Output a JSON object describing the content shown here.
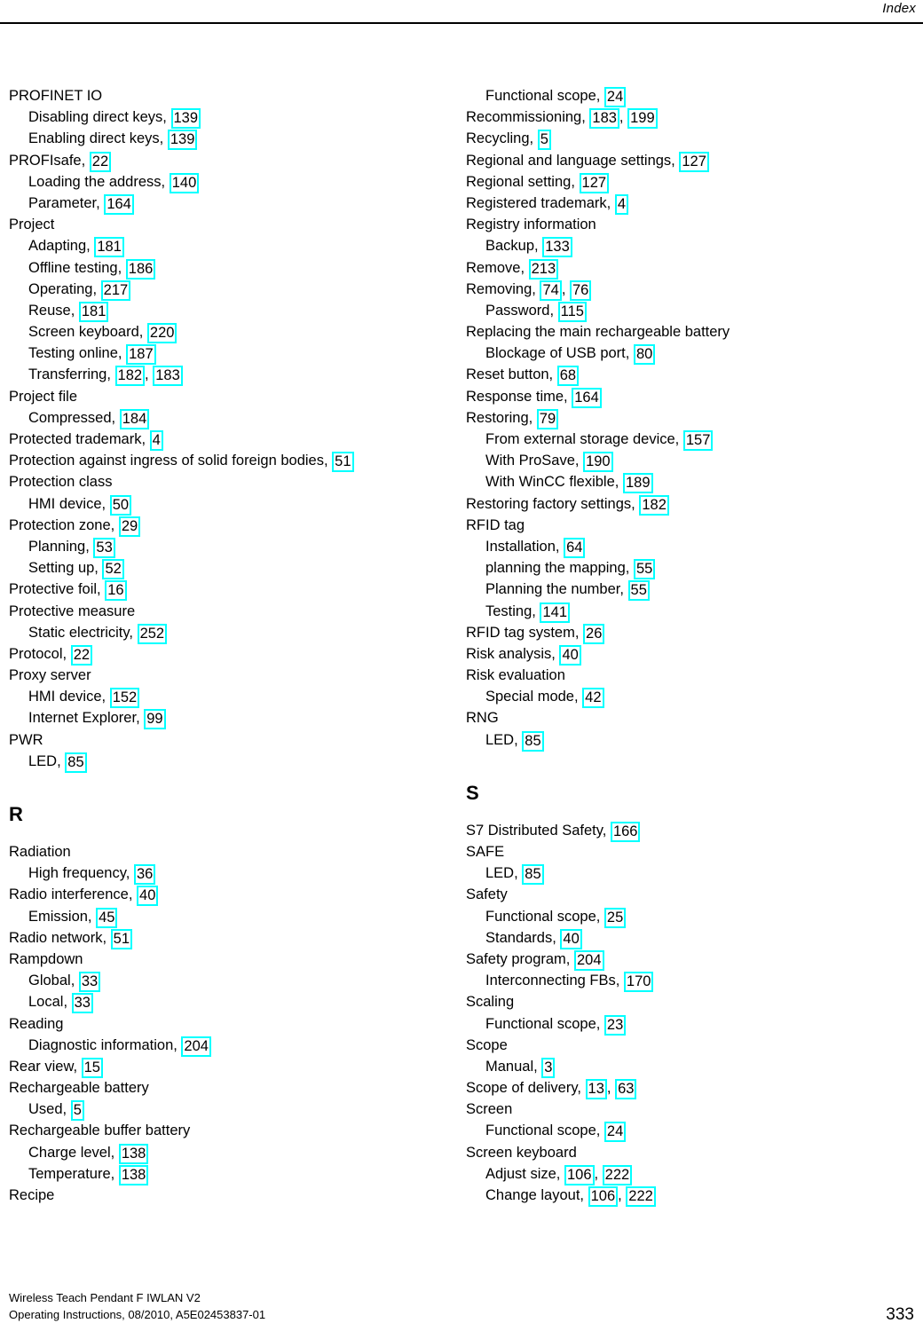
{
  "header": {
    "title": "Index"
  },
  "footer": {
    "line1": "Wireless Teach Pendant F IWLAN V2",
    "line2": "Operating Instructions, 08/2010, A5E02453837-01",
    "page_number": "333"
  },
  "colors": {
    "highlight_border": "#00ffff",
    "text": "#000000",
    "background": "#ffffff"
  },
  "columns": {
    "left": [
      {
        "type": "entry",
        "level": 1,
        "text": "PROFINET IO",
        "pages": []
      },
      {
        "type": "entry",
        "level": 2,
        "text": "Disabling direct keys,",
        "pages": [
          "139"
        ]
      },
      {
        "type": "entry",
        "level": 2,
        "text": "Enabling direct keys,",
        "pages": [
          "139"
        ]
      },
      {
        "type": "entry",
        "level": 1,
        "text": "PROFIsafe,",
        "pages": [
          "22"
        ]
      },
      {
        "type": "entry",
        "level": 2,
        "text": "Loading the address,",
        "pages": [
          "140"
        ]
      },
      {
        "type": "entry",
        "level": 2,
        "text": "Parameter,",
        "pages": [
          "164"
        ]
      },
      {
        "type": "entry",
        "level": 1,
        "text": "Project",
        "pages": []
      },
      {
        "type": "entry",
        "level": 2,
        "text": "Adapting,",
        "pages": [
          "181"
        ]
      },
      {
        "type": "entry",
        "level": 2,
        "text": "Offline testing,",
        "pages": [
          "186"
        ]
      },
      {
        "type": "entry",
        "level": 2,
        "text": "Operating,",
        "pages": [
          "217"
        ]
      },
      {
        "type": "entry",
        "level": 2,
        "text": "Reuse,",
        "pages": [
          "181"
        ]
      },
      {
        "type": "entry",
        "level": 2,
        "text": "Screen keyboard,",
        "pages": [
          "220"
        ]
      },
      {
        "type": "entry",
        "level": 2,
        "text": "Testing online,",
        "pages": [
          "187"
        ]
      },
      {
        "type": "entry",
        "level": 2,
        "text": "Transferring,",
        "pages": [
          "182",
          "183"
        ]
      },
      {
        "type": "entry",
        "level": 1,
        "text": "Project file",
        "pages": []
      },
      {
        "type": "entry",
        "level": 2,
        "text": "Compressed,",
        "pages": [
          "184"
        ]
      },
      {
        "type": "entry",
        "level": 1,
        "text": "Protected trademark,",
        "pages": [
          "4"
        ]
      },
      {
        "type": "entry",
        "level": 1,
        "text": "Protection against ingress of solid foreign bodies,",
        "pages": [
          "51"
        ]
      },
      {
        "type": "entry",
        "level": 1,
        "text": "Protection class",
        "pages": []
      },
      {
        "type": "entry",
        "level": 2,
        "text": "HMI device,",
        "pages": [
          "50"
        ]
      },
      {
        "type": "entry",
        "level": 1,
        "text": "Protection zone,",
        "pages": [
          "29"
        ]
      },
      {
        "type": "entry",
        "level": 2,
        "text": "Planning,",
        "pages": [
          "53"
        ]
      },
      {
        "type": "entry",
        "level": 2,
        "text": "Setting up,",
        "pages": [
          "52"
        ]
      },
      {
        "type": "entry",
        "level": 1,
        "text": "Protective foil,",
        "pages": [
          "16"
        ]
      },
      {
        "type": "entry",
        "level": 1,
        "text": "Protective measure",
        "pages": []
      },
      {
        "type": "entry",
        "level": 2,
        "text": "Static electricity,",
        "pages": [
          "252"
        ]
      },
      {
        "type": "entry",
        "level": 1,
        "text": "Protocol,",
        "pages": [
          "22"
        ]
      },
      {
        "type": "entry",
        "level": 1,
        "text": "Proxy server",
        "pages": []
      },
      {
        "type": "entry",
        "level": 2,
        "text": "HMI device,",
        "pages": [
          "152"
        ]
      },
      {
        "type": "entry",
        "level": 2,
        "text": "Internet Explorer,",
        "pages": [
          "99"
        ]
      },
      {
        "type": "entry",
        "level": 1,
        "text": "PWR",
        "pages": []
      },
      {
        "type": "entry",
        "level": 2,
        "text": "LED,",
        "pages": [
          "85"
        ]
      },
      {
        "type": "heading",
        "text": "R"
      },
      {
        "type": "entry",
        "level": 1,
        "text": "Radiation",
        "pages": []
      },
      {
        "type": "entry",
        "level": 2,
        "text": "High frequency,",
        "pages": [
          "36"
        ]
      },
      {
        "type": "entry",
        "level": 1,
        "text": "Radio interference,",
        "pages": [
          "40"
        ]
      },
      {
        "type": "entry",
        "level": 2,
        "text": "Emission,",
        "pages": [
          "45"
        ]
      },
      {
        "type": "entry",
        "level": 1,
        "text": "Radio network,",
        "pages": [
          "51"
        ]
      },
      {
        "type": "entry",
        "level": 1,
        "text": "Rampdown",
        "pages": []
      },
      {
        "type": "entry",
        "level": 2,
        "text": "Global,",
        "pages": [
          "33"
        ]
      },
      {
        "type": "entry",
        "level": 2,
        "text": "Local,",
        "pages": [
          "33"
        ]
      },
      {
        "type": "entry",
        "level": 1,
        "text": "Reading",
        "pages": []
      },
      {
        "type": "entry",
        "level": 2,
        "text": "Diagnostic information,",
        "pages": [
          "204"
        ]
      },
      {
        "type": "entry",
        "level": 1,
        "text": "Rear view,",
        "pages": [
          "15"
        ]
      },
      {
        "type": "entry",
        "level": 1,
        "text": "Rechargeable battery",
        "pages": []
      },
      {
        "type": "entry",
        "level": 2,
        "text": "Used,",
        "pages": [
          "5"
        ]
      },
      {
        "type": "entry",
        "level": 1,
        "text": "Rechargeable buffer battery",
        "pages": []
      },
      {
        "type": "entry",
        "level": 2,
        "text": "Charge level,",
        "pages": [
          "138"
        ]
      },
      {
        "type": "entry",
        "level": 2,
        "text": "Temperature,",
        "pages": [
          "138"
        ]
      },
      {
        "type": "entry",
        "level": 1,
        "text": "Recipe",
        "pages": []
      }
    ],
    "right": [
      {
        "type": "entry",
        "level": 2,
        "text": "Functional scope,",
        "pages": [
          "24"
        ]
      },
      {
        "type": "entry",
        "level": 1,
        "text": "Recommissioning,",
        "pages": [
          "183",
          "199"
        ]
      },
      {
        "type": "entry",
        "level": 1,
        "text": "Recycling,",
        "pages": [
          "5"
        ]
      },
      {
        "type": "entry",
        "level": 1,
        "text": "Regional and language settings,",
        "pages": [
          "127"
        ]
      },
      {
        "type": "entry",
        "level": 1,
        "text": "Regional setting,",
        "pages": [
          "127"
        ]
      },
      {
        "type": "entry",
        "level": 1,
        "text": "Registered trademark,",
        "pages": [
          "4"
        ]
      },
      {
        "type": "entry",
        "level": 1,
        "text": "Registry information",
        "pages": []
      },
      {
        "type": "entry",
        "level": 2,
        "text": "Backup,",
        "pages": [
          "133"
        ]
      },
      {
        "type": "entry",
        "level": 1,
        "text": "Remove,",
        "pages": [
          "213"
        ]
      },
      {
        "type": "entry",
        "level": 1,
        "text": "Removing,",
        "pages": [
          "74",
          "76"
        ]
      },
      {
        "type": "entry",
        "level": 2,
        "text": "Password,",
        "pages": [
          "115"
        ]
      },
      {
        "type": "entry",
        "level": 1,
        "text": "Replacing the main rechargeable battery",
        "pages": []
      },
      {
        "type": "entry",
        "level": 2,
        "text": "Blockage of USB port,",
        "pages": [
          "80"
        ]
      },
      {
        "type": "entry",
        "level": 1,
        "text": "Reset button,",
        "pages": [
          "68"
        ]
      },
      {
        "type": "entry",
        "level": 1,
        "text": "Response time,",
        "pages": [
          "164"
        ]
      },
      {
        "type": "entry",
        "level": 1,
        "text": "Restoring,",
        "pages": [
          "79"
        ]
      },
      {
        "type": "entry",
        "level": 2,
        "text": "From external storage device,",
        "pages": [
          "157"
        ]
      },
      {
        "type": "entry",
        "level": 2,
        "text": "With ProSave,",
        "pages": [
          "190"
        ]
      },
      {
        "type": "entry",
        "level": 2,
        "text": "With WinCC flexible,",
        "pages": [
          "189"
        ]
      },
      {
        "type": "entry",
        "level": 1,
        "text": "Restoring factory settings,",
        "pages": [
          "182"
        ]
      },
      {
        "type": "entry",
        "level": 1,
        "text": "RFID tag",
        "pages": []
      },
      {
        "type": "entry",
        "level": 2,
        "text": "Installation,",
        "pages": [
          "64"
        ]
      },
      {
        "type": "entry",
        "level": 2,
        "text": "planning the mapping,",
        "pages": [
          "55"
        ]
      },
      {
        "type": "entry",
        "level": 2,
        "text": "Planning the number,",
        "pages": [
          "55"
        ]
      },
      {
        "type": "entry",
        "level": 2,
        "text": "Testing,",
        "pages": [
          "141"
        ]
      },
      {
        "type": "entry",
        "level": 1,
        "text": "RFID tag system,",
        "pages": [
          "26"
        ]
      },
      {
        "type": "entry",
        "level": 1,
        "text": "Risk analysis,",
        "pages": [
          "40"
        ]
      },
      {
        "type": "entry",
        "level": 1,
        "text": "Risk evaluation",
        "pages": []
      },
      {
        "type": "entry",
        "level": 2,
        "text": "Special mode,",
        "pages": [
          "42"
        ]
      },
      {
        "type": "entry",
        "level": 1,
        "text": "RNG",
        "pages": []
      },
      {
        "type": "entry",
        "level": 2,
        "text": "LED,",
        "pages": [
          "85"
        ]
      },
      {
        "type": "heading",
        "text": "S"
      },
      {
        "type": "entry",
        "level": 1,
        "text": "S7 Distributed Safety,",
        "pages": [
          "166"
        ]
      },
      {
        "type": "entry",
        "level": 1,
        "text": "SAFE",
        "pages": []
      },
      {
        "type": "entry",
        "level": 2,
        "text": "LED,",
        "pages": [
          "85"
        ]
      },
      {
        "type": "entry",
        "level": 1,
        "text": "Safety",
        "pages": []
      },
      {
        "type": "entry",
        "level": 2,
        "text": "Functional scope,",
        "pages": [
          "25"
        ]
      },
      {
        "type": "entry",
        "level": 2,
        "text": "Standards,",
        "pages": [
          "40"
        ]
      },
      {
        "type": "entry",
        "level": 1,
        "text": "Safety program,",
        "pages": [
          "204"
        ]
      },
      {
        "type": "entry",
        "level": 2,
        "text": "Interconnecting FBs,",
        "pages": [
          "170"
        ]
      },
      {
        "type": "entry",
        "level": 1,
        "text": "Scaling",
        "pages": []
      },
      {
        "type": "entry",
        "level": 2,
        "text": "Functional scope,",
        "pages": [
          "23"
        ]
      },
      {
        "type": "entry",
        "level": 1,
        "text": "Scope",
        "pages": []
      },
      {
        "type": "entry",
        "level": 2,
        "text": "Manual,",
        "pages": [
          "3"
        ]
      },
      {
        "type": "entry",
        "level": 1,
        "text": "Scope of delivery,",
        "pages": [
          "13",
          "63"
        ]
      },
      {
        "type": "entry",
        "level": 1,
        "text": "Screen",
        "pages": []
      },
      {
        "type": "entry",
        "level": 2,
        "text": "Functional scope,",
        "pages": [
          "24"
        ]
      },
      {
        "type": "entry",
        "level": 1,
        "text": "Screen keyboard",
        "pages": []
      },
      {
        "type": "entry",
        "level": 2,
        "text": "Adjust size,",
        "pages": [
          "106",
          "222"
        ]
      },
      {
        "type": "entry",
        "level": 2,
        "text": "Change layout,",
        "pages": [
          "106",
          "222"
        ]
      }
    ]
  }
}
